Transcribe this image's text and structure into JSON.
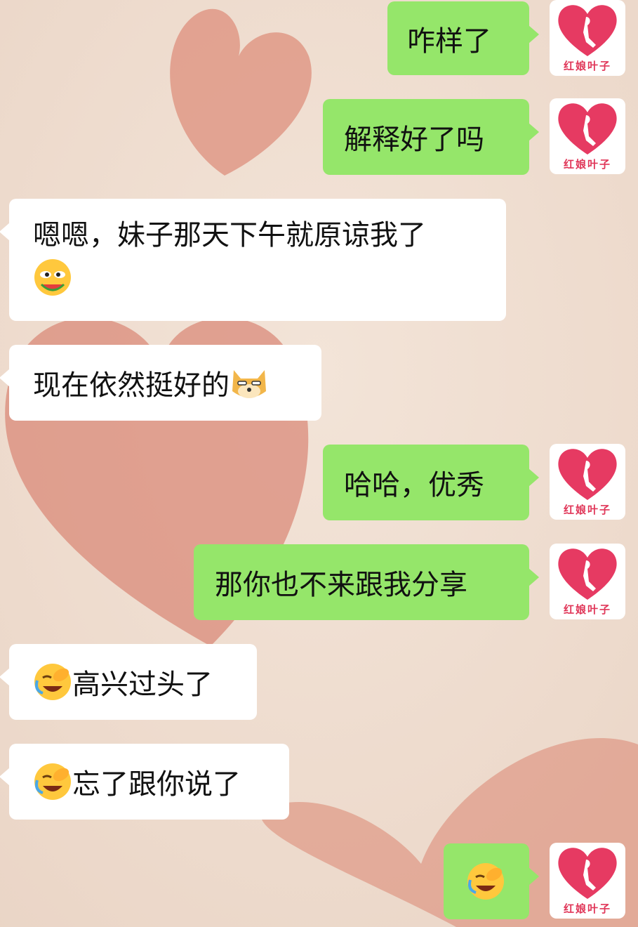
{
  "chat": {
    "avatar_label": "红娘叶子",
    "messages": [
      {
        "from": "me",
        "text": "咋样了"
      },
      {
        "from": "me",
        "text": "解释好了吗"
      },
      {
        "from": "them",
        "text": "嗯嗯，妹子那天下午就原谅我了",
        "emoji_after": "eating-watermelon-emoji"
      },
      {
        "from": "them",
        "text": "现在依然挺好的",
        "emoji_after": "doge-emoji"
      },
      {
        "from": "me",
        "text": "哈哈，优秀"
      },
      {
        "from": "me",
        "text": "那你也不来跟我分享"
      },
      {
        "from": "them",
        "text": "高兴过头了",
        "emoji_before": "facepalm-laugh-emoji"
      },
      {
        "from": "them",
        "text": "忘了跟你说了",
        "emoji_before": "facepalm-laugh-emoji"
      },
      {
        "from": "me",
        "text": "",
        "emoji_only": "facepalm-laugh-emoji"
      }
    ]
  },
  "colors": {
    "my_bubble": "#95e66a",
    "their_bubble": "#ffffff",
    "avatar_heart": "#e63a62",
    "background": "#efddd0"
  }
}
